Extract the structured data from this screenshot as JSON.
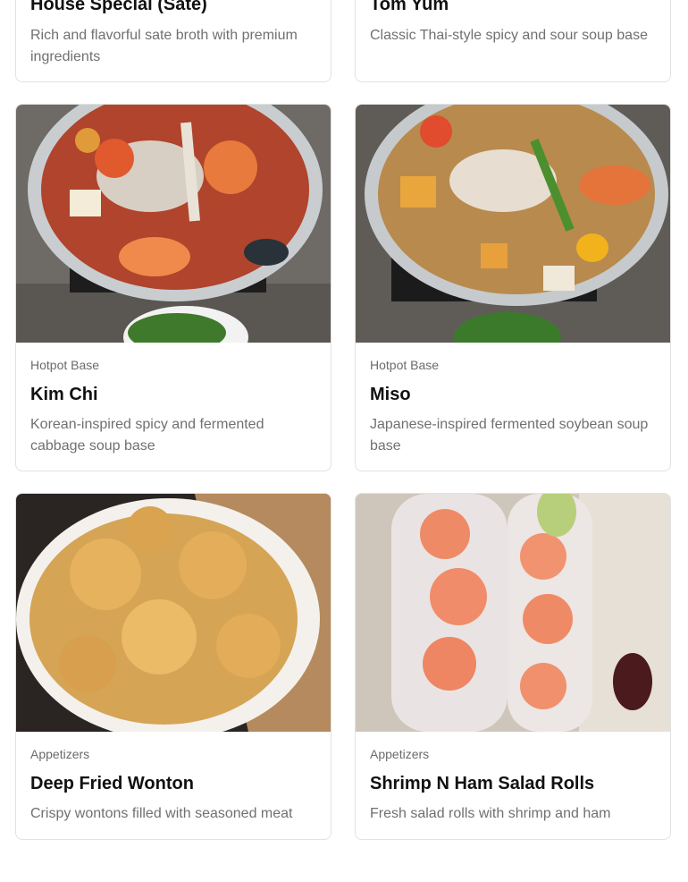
{
  "menu": {
    "top_cards": [
      {
        "title": "House Special (Sate)",
        "description": "Rich and flavorful sate broth with premium ingredients"
      },
      {
        "title": "Tom Yum",
        "description": "Classic Thai-style spicy and sour soup base"
      }
    ],
    "cards": [
      {
        "category": "Hotpot Base",
        "title": "Kim Chi",
        "description": "Korean-inspired spicy and fermented cabbage soup base",
        "image": "kimchi-hotpot-photo"
      },
      {
        "category": "Hotpot Base",
        "title": "Miso",
        "description": "Japanese-inspired fermented soybean soup base",
        "image": "miso-hotpot-photo"
      },
      {
        "category": "Appetizers",
        "title": "Deep Fried Wonton",
        "description": "Crispy wontons filled with seasoned meat",
        "image": "fried-wonton-photo"
      },
      {
        "category": "Appetizers",
        "title": "Shrimp N Ham Salad Rolls",
        "description": "Fresh salad rolls with shrimp and ham",
        "image": "salad-rolls-photo"
      }
    ]
  }
}
